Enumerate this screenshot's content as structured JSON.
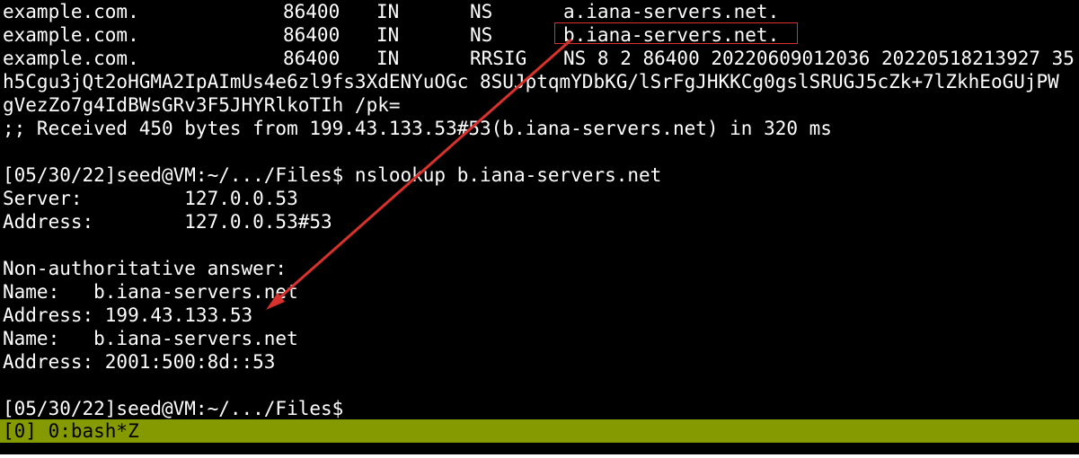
{
  "dig_records": [
    {
      "name": "example.com.",
      "ttl": "86400",
      "class": "IN",
      "type": "NS",
      "data": "a.iana-servers.net."
    },
    {
      "name": "example.com.",
      "ttl": "86400",
      "class": "IN",
      "type": "NS",
      "data": "b.iana-servers.net."
    },
    {
      "name": "example.com.",
      "ttl": "86400",
      "class": "IN",
      "type": "RRSIG",
      "data": "NS 8 2 86400 20220609012036 20220518213927 35"
    }
  ],
  "rrsig_continuation": [
    "h5Cgu3jQt2oHGMA2IpAImUs4e6zl9fs3XdENYuOGc 8SUJptqmYDbKG/lSrFgJHKKCg0gslSRUGJ5cZk+7lZkhEoGUjPW",
    "gVezZo7g4IdBWsGRv3F5JHYRlkoTIh /pk="
  ],
  "received_line": ";; Received 450 bytes from 199.43.133.53#53(b.iana-servers.net) in 320 ms",
  "prompt_command": "[05/30/22]seed@VM:~/.../Files$ nslookup b.iana-servers.net",
  "server_line": "Server:         127.0.0.53",
  "address_line": "Address:        127.0.0.53#53",
  "non_auth": "Non-authoritative answer:",
  "answers": [
    {
      "name_line": "Name:   b.iana-servers.net",
      "address_line": "Address: 199.43.133.53"
    },
    {
      "name_line": "Name:   b.iana-servers.net",
      "address_line": "Address: 2001:500:8d::53"
    }
  ],
  "final_prompt": "[05/30/22]seed@VM:~/.../Files$",
  "status_bar": "[0] 0:bash*Z",
  "colors": {
    "background": "#000000",
    "text": "#ffffff",
    "status_bar": "#859900",
    "annotation": "#d9312b"
  }
}
